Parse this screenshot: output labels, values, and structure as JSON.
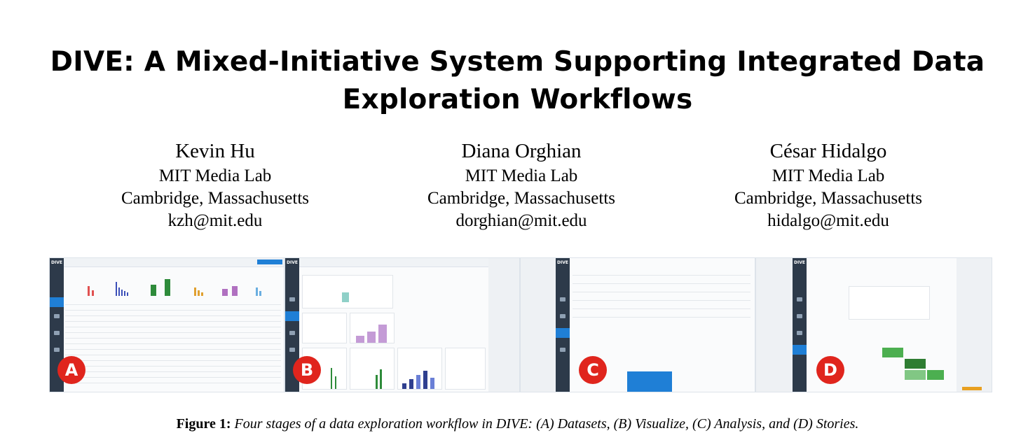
{
  "paper": {
    "title_line1": "DIVE: A Mixed-Initiative System Supporting Integrated Data",
    "title_line2": "Exploration Workflows",
    "authors": [
      {
        "name": "Kevin Hu",
        "affiliation": "MIT Media Lab",
        "location": "Cambridge, Massachusetts",
        "email": "kzh@mit.edu"
      },
      {
        "name": "Diana Orghian",
        "affiliation": "MIT Media Lab",
        "location": "Cambridge, Massachusetts",
        "email": "dorghian@mit.edu"
      },
      {
        "name": "César Hidalgo",
        "affiliation": "MIT Media Lab",
        "location": "Cambridge, Massachusetts",
        "email": "hidalgo@mit.edu"
      }
    ]
  },
  "figure": {
    "panels": [
      {
        "badge": "A",
        "app_logo": "DIVE"
      },
      {
        "badge": "B",
        "app_logo": "DIVE"
      },
      {
        "badge": "C",
        "app_logo": "DIVE"
      },
      {
        "badge": "D",
        "app_logo": "DIVE"
      }
    ],
    "accent_color": "#1f7fd6",
    "badge_color": "#e0251d",
    "caption_label": "Figure 1:",
    "caption_text": "Four stages of a data exploration workflow in DIVE: (A) Datasets, (B) Visualize, (C) Analysis, and (D) Stories."
  }
}
